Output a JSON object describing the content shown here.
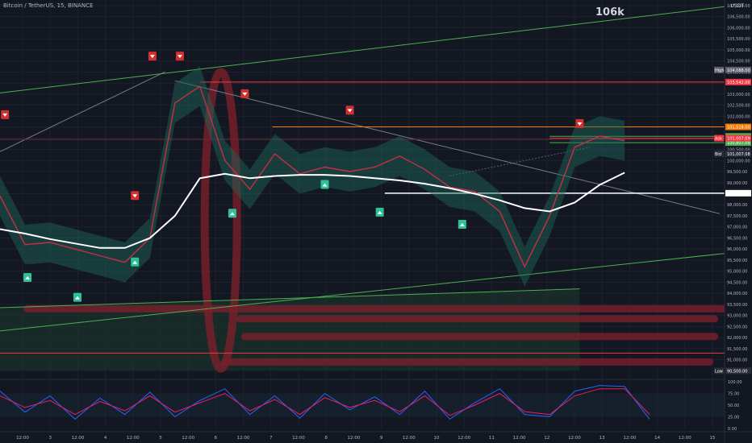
{
  "header": {
    "title": "Bitcoin / TetherUS, 15, BINANCE",
    "annotation": "106k",
    "quote_currency": "USDT"
  },
  "chart_data": {
    "type": "line",
    "title": "Bitcoin / TetherUS, 15, BINANCE",
    "xlabel": "",
    "ylabel": "",
    "ylim": [
      90150,
      107250
    ],
    "price_ticks": [
      91000,
      91500,
      92000,
      92500,
      93000,
      93500,
      94000,
      94500,
      95000,
      95500,
      96000,
      96500,
      97000,
      97500,
      98000,
      98500,
      99000,
      99500,
      100000,
      100500,
      101000,
      101500,
      102000,
      102500,
      103000,
      103500,
      104000,
      104500,
      105000,
      105500,
      106000,
      106500,
      107000
    ],
    "price_tick_labels": [
      "91,000.00",
      "91,500.00",
      "92,000.00",
      "92,500.00",
      "93,000.00",
      "93,500.00",
      "94,000.00",
      "94,500.00",
      "95,000.00",
      "95,500.00",
      "96,000.00",
      "96,500.00",
      "97,000.00",
      "97,500.00",
      "98,000.00",
      "98,500.00",
      "99,000.00",
      "99,500.00",
      "100,000.00",
      "100,500.00",
      "101,000.00",
      "101,500.00",
      "102,000.00",
      "102,500.00",
      "103,000.00",
      "103,500.00",
      "104,000.00",
      "104,500.00",
      "105,000.00",
      "105,500.00",
      "106,000.00",
      "106,500.00",
      "107,000.00"
    ],
    "time_labels": [
      "12:00",
      "3",
      "12:00",
      "4",
      "12:00",
      "5",
      "12:00",
      "6",
      "12:00",
      "7",
      "12:00",
      "8",
      "12:00",
      "9",
      "12:00",
      "10",
      "12:00",
      "11",
      "12:00",
      "12",
      "12:00",
      "13",
      "12:00",
      "14",
      "12:00",
      "15"
    ],
    "x": [
      0,
      0.5,
      1,
      1.5,
      2,
      2.5,
      3,
      3.5,
      4,
      4.5,
      5,
      5.5,
      6,
      6.5,
      7,
      7.5,
      8,
      8.5,
      9,
      9.5,
      10,
      10.5,
      11,
      11.5,
      12,
      12.5,
      13,
      13.5,
      14
    ],
    "price": [
      98400,
      96200,
      96300,
      96000,
      95700,
      95400,
      96500,
      102600,
      103350,
      100000,
      98700,
      100300,
      99400,
      99700,
      99500,
      99700,
      100200,
      99600,
      98800,
      98600,
      97700,
      95200,
      97500,
      100600,
      101100,
      100900,
      null,
      null,
      null
    ],
    "ma": [
      96900,
      96700,
      96450,
      96250,
      96050,
      96050,
      96500,
      97500,
      99200,
      99400,
      99200,
      99300,
      99350,
      99350,
      99300,
      99200,
      99100,
      98950,
      98750,
      98500,
      98200,
      97850,
      97700,
      98100,
      98900,
      99450,
      null,
      null,
      null
    ],
    "levels": [
      {
        "label": "High",
        "value": 104088,
        "text": "104,088.00",
        "color": "#5d606b"
      },
      {
        "label": "",
        "value": 103542,
        "text": "103,542.00",
        "color": "#f23645"
      },
      {
        "label": "",
        "value": 101518,
        "text": "101,518.00",
        "color": "#f57c00"
      },
      {
        "label": "",
        "value": 101090,
        "text": "101,090.00",
        "color": "#4caf50"
      },
      {
        "label": "",
        "value": 100807,
        "text": "100,807.09",
        "color": "#4caf50"
      },
      {
        "label": "Ask",
        "value": 101007,
        "text": "101,007.09",
        "color": "#f23645"
      },
      {
        "label": "Bid",
        "value": 100307,
        "text": "101,007.08",
        "color": "#2a2e39"
      },
      {
        "label": "",
        "value": 98524,
        "text": "98,524.41",
        "color": "#ffffff"
      },
      {
        "label": "Low",
        "value": 90500,
        "text": "90,500.00",
        "color": "#2a2e39"
      }
    ],
    "oscillator_ylim": [
      0,
      100
    ],
    "oscillator_ticks": [
      0,
      25,
      50,
      75,
      100
    ],
    "oscillator_tick_labels": [
      "0.00",
      "25.00",
      "50.00",
      "75.00",
      "100.00"
    ],
    "oscillator_series": [
      {
        "values": [
          80,
          35,
          70,
          20,
          65,
          30,
          78,
          25,
          60,
          85,
          30,
          70,
          22,
          75,
          40,
          68,
          30,
          80,
          20,
          55,
          85,
          30,
          25,
          80,
          92,
          90,
          20,
          null,
          null
        ],
        "color": "#2962ff"
      },
      {
        "values": [
          70,
          45,
          60,
          30,
          58,
          38,
          70,
          35,
          55,
          75,
          38,
          62,
          30,
          66,
          45,
          60,
          36,
          70,
          28,
          50,
          75,
          36,
          30,
          70,
          85,
          85,
          30,
          null,
          null
        ],
        "color": "#e91e63"
      }
    ]
  },
  "colors": {
    "background": "#131722",
    "grid": "#1e222d",
    "bullish": "#26a69a",
    "bearish": "#ef5350",
    "signal_up": "#2cc295",
    "signal_down": "#d32f2f",
    "ma_line": "#ffffff",
    "trend_line": "#4caf50",
    "resistance": "#f23645",
    "orange_level": "#f57c00"
  }
}
